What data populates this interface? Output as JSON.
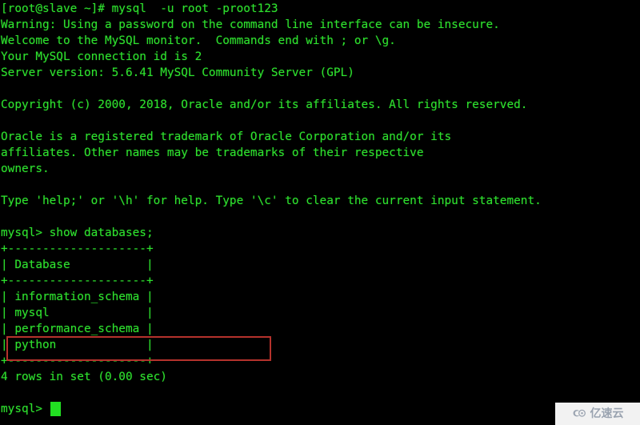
{
  "terminal": {
    "colors": {
      "background": "#000000",
      "foreground": "#2ee02e",
      "cursor": "#22e022",
      "highlight_border": "#b5322c",
      "watermark_background": "#f2f2f2",
      "watermark_text": "#9aa3b0"
    },
    "lines": [
      "[root@slave ~]# mysql  -u root -proot123",
      "Warning: Using a password on the command line interface can be insecure.",
      "Welcome to the MySQL monitor.  Commands end with ; or \\g.",
      "Your MySQL connection id is 2",
      "Server version: 5.6.41 MySQL Community Server (GPL)",
      "",
      "Copyright (c) 2000, 2018, Oracle and/or its affiliates. All rights reserved.",
      "",
      "Oracle is a registered trademark of Oracle Corporation and/or its",
      "affiliates. Other names may be trademarks of their respective",
      "owners.",
      "",
      "Type 'help;' or '\\h' for help. Type '\\c' to clear the current input statement.",
      "",
      "mysql> show databases;",
      "+--------------------+",
      "| Database           |",
      "+--------------------+",
      "| information_schema |",
      "| mysql              |",
      "| performance_schema |",
      "| python             |",
      "+--------------------+",
      "4 rows in set (0.00 sec)",
      ""
    ],
    "prompt": {
      "text": "mysql> ",
      "cursor_visible": true
    },
    "command_entered": "show databases;",
    "shell_prompt": "[root@slave ~]#",
    "command_line": "mysql  -u root -proot123",
    "result_table": {
      "header": [
        "Database"
      ],
      "rows": [
        [
          "information_schema"
        ],
        [
          "mysql"
        ],
        [
          "performance_schema"
        ],
        [
          "python"
        ]
      ],
      "separator": "+--------------------+",
      "row_count_text": "4 rows in set (0.00 sec)",
      "highlighted_row": "python"
    },
    "server_info": {
      "version": "5.6.41 MySQL Community Server (GPL)",
      "connection_id": "2"
    }
  },
  "watermark": {
    "text": "亿速云",
    "logo_name": "cloud-logo"
  }
}
